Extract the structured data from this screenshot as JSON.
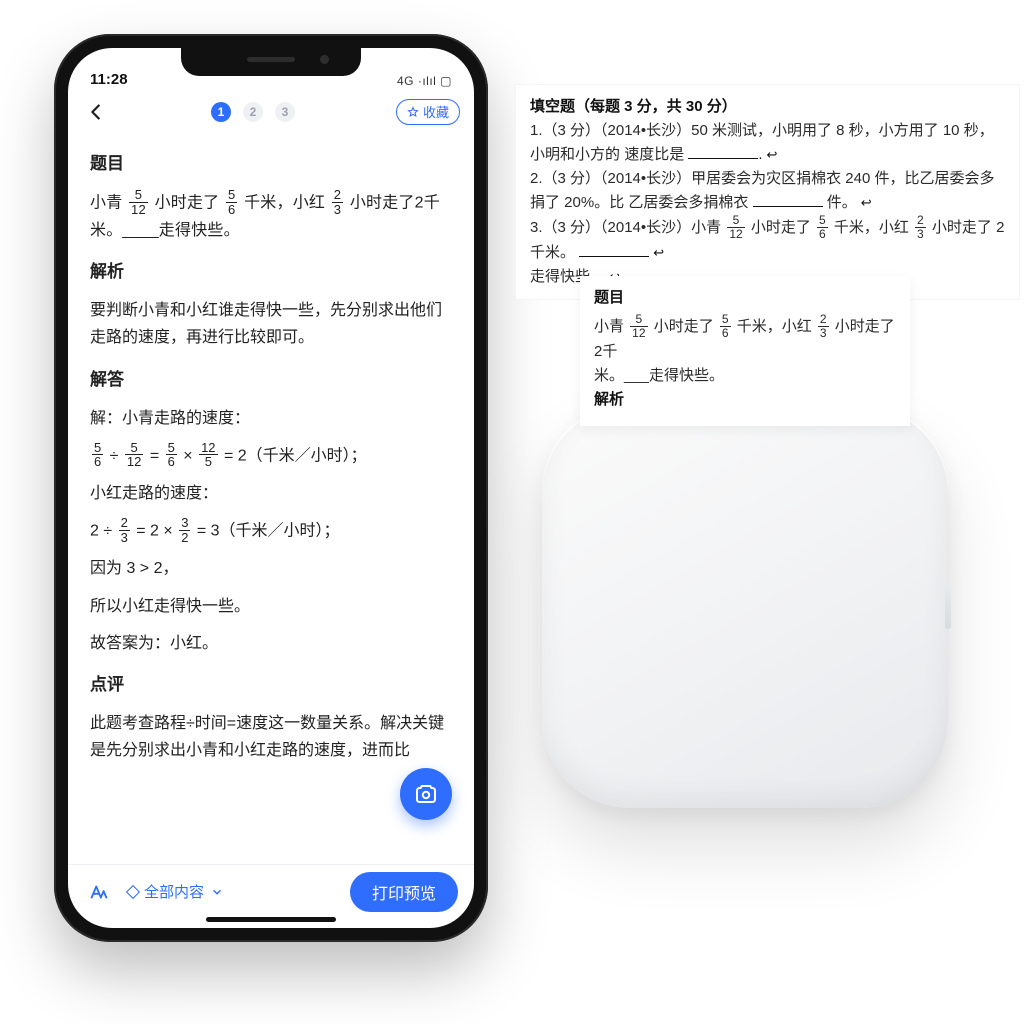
{
  "status": {
    "time": "11:28",
    "network": "4G ·ılıl ▢"
  },
  "header": {
    "pager": [
      "1",
      "2",
      "3"
    ],
    "fav_label": "收藏"
  },
  "sections": {
    "topic_h": "题目",
    "topic_p": "小青 5/12 小时走了 5/6 千米，小红 2/3 小时走了2千米。____走得快些。",
    "analysis_h": "解析",
    "analysis_p": "要判断小青和小红谁走得快一些，先分别求出他们走路的速度，再进行比较即可。",
    "answer_h": "解答",
    "answer_l1": "解：小青走路的速度：",
    "answer_l2": "5/6 ÷ 5/12 = 5/6 × 12/5 = 2（千米／小时）；",
    "answer_l3": "小红走路的速度：",
    "answer_l4": "2 ÷ 2/3 = 2 × 3/2 = 3（千米／小时）；",
    "answer_l5": "因为 3 > 2，",
    "answer_l6": "所以小红走得快一些。",
    "answer_l7": "故答案为：小红。",
    "review_h": "点评",
    "review_p": "此题考查路程÷时间=速度这一数量关系。解决关键是先分别求出小青和小红走路的速度，进而比"
  },
  "bottom": {
    "scope_label": "全部内容",
    "print_label": "打印预览"
  },
  "wide_paper": {
    "title": "填空题（每题 3 分，共 30 分）",
    "l1a": "1.（3 分）（2014•长沙）50 米测试，小明用了 8 秒，小方用了 10 秒，小明和小方的",
    "l1b": "速度比是",
    "l2a": "2.（3 分）（2014•长沙）甲居委会为灾区捐棉衣 240 件，比乙居委会多捐了 20%。比",
    "l2b": "乙居委会多捐棉衣",
    "l2c": "件。",
    "l3a": "3.（3 分）（2014•长沙）小青 5/12 小时走了 5/6 千米，小红 2/3 小时走了 2 千米。",
    "l3b": "走得快些。"
  },
  "narrow_paper": {
    "topic_h": "题目",
    "topic_p": "小青 5/12 小时走了 5/6 千米，小红 2/3 小时走了2千米。___走得快些。",
    "analysis_h": "解析"
  }
}
